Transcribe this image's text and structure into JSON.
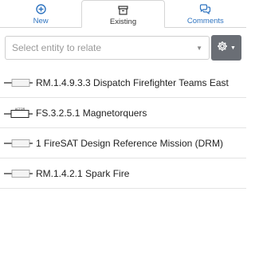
{
  "tabs": [
    {
      "label": "New",
      "icon": "plus-circle-icon",
      "active": false
    },
    {
      "label": "Existing",
      "icon": "archive-box-icon",
      "active": true
    },
    {
      "label": "Comments",
      "icon": "comments-icon",
      "active": false
    }
  ],
  "search": {
    "placeholder": "Select entity to relate"
  },
  "settings_button": {
    "icon": "gear-icon"
  },
  "items": [
    {
      "label": "RM.1.4.9.3.3 Dispatch Firefighter Teams East",
      "icon": "block-connector-icon"
    },
    {
      "label": "FS.3.2.5.1 Magnetorquers",
      "icon": "actor-block-icon",
      "badge": "ACTOR"
    },
    {
      "label": "1 FireSAT Design Reference Mission (DRM)",
      "icon": "block-connector-icon"
    },
    {
      "label": "RM.1.4.2.1 Spark Fire",
      "icon": "block-connector-icon"
    }
  ],
  "colors": {
    "accent": "#2f74c0",
    "gear_bg": "#6a6e75",
    "divider": "#e3e3e3"
  }
}
